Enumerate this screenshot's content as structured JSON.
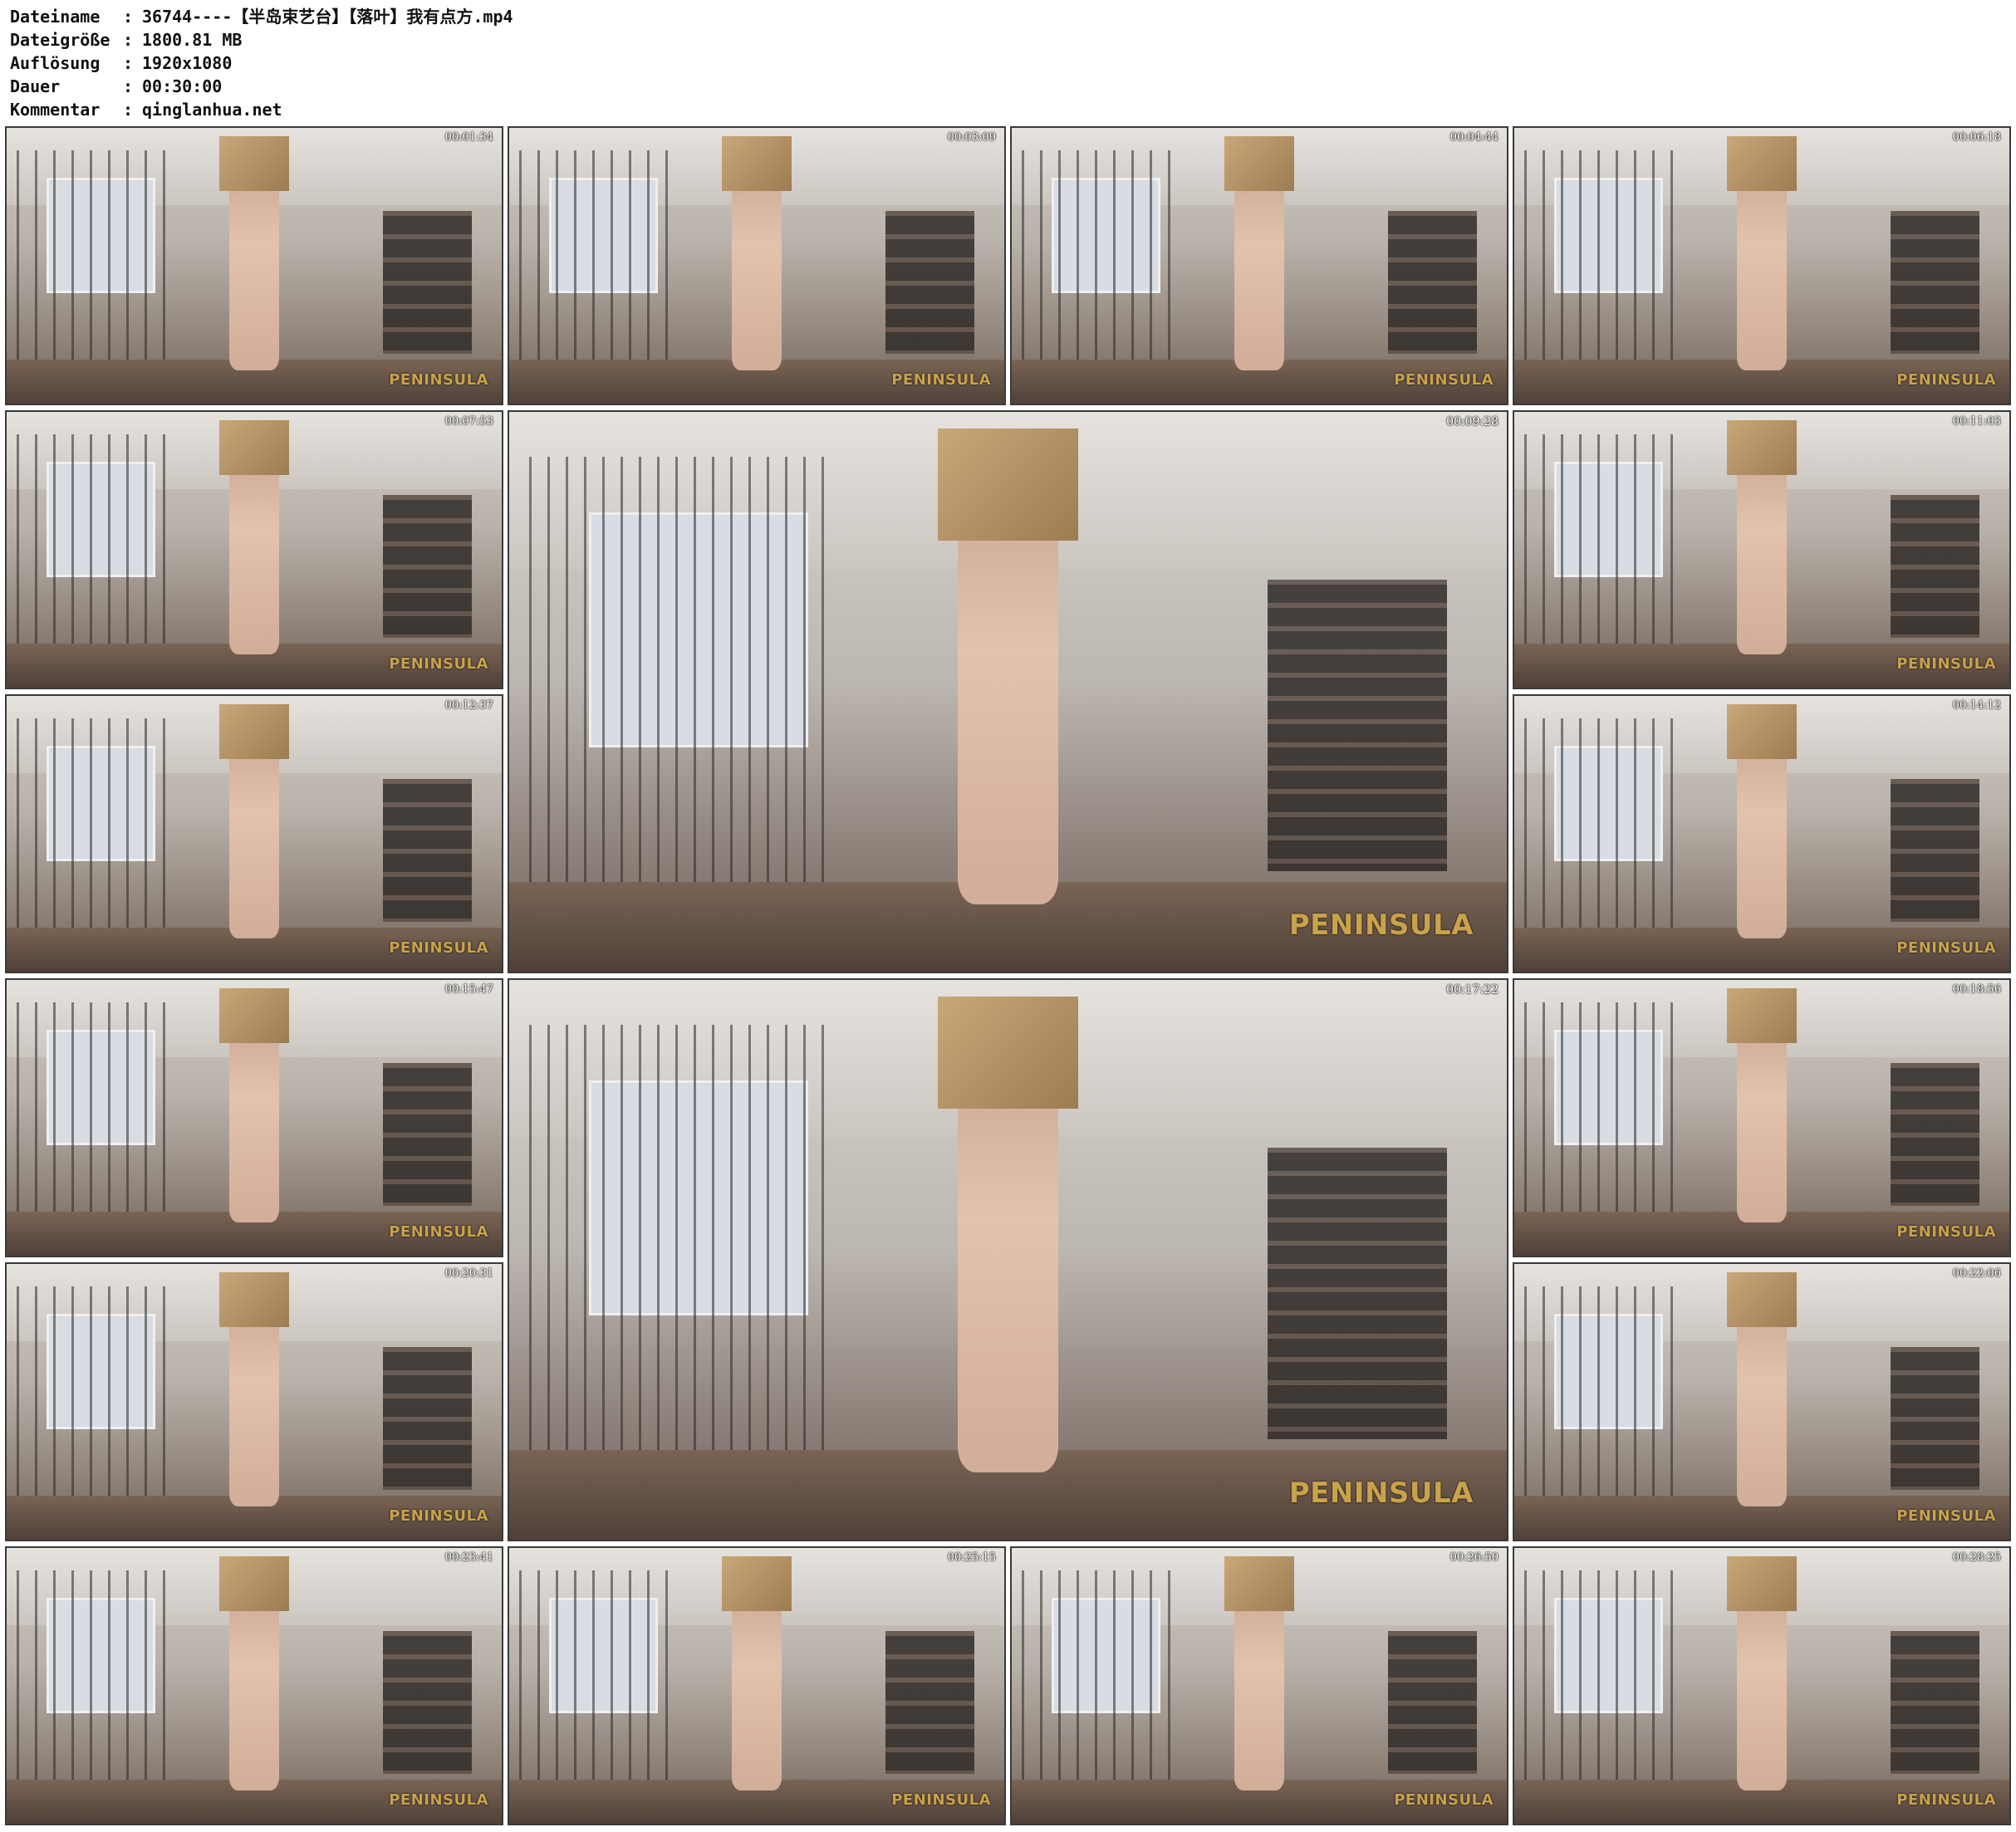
{
  "header": {
    "rows": [
      {
        "label": "Dateiname",
        "sep": ":",
        "value": "36744----【半岛束艺台】【落叶】我有点方.mp4"
      },
      {
        "label": "Dateigröße",
        "sep": ":",
        "value": "1800.81 MB"
      },
      {
        "label": "Auflösung",
        "sep": ":",
        "value": "1920x1080"
      },
      {
        "label": "Dauer",
        "sep": ":",
        "value": "00:30:00"
      },
      {
        "label": "Kommentar",
        "sep": ":",
        "value": "qinglanhua.net"
      }
    ]
  },
  "logo_text": "PENINSULA",
  "thumbnails": [
    {
      "timestamp": "00:01:34",
      "large": false
    },
    {
      "timestamp": "00:03:09",
      "large": false
    },
    {
      "timestamp": "00:04:44",
      "large": false
    },
    {
      "timestamp": "00:06:18",
      "large": false
    },
    {
      "timestamp": "00:07:53",
      "large": false
    },
    {
      "timestamp": "00:09:28",
      "large": true
    },
    {
      "timestamp": "00:11:03",
      "large": false
    },
    {
      "timestamp": "00:12:37",
      "large": false
    },
    {
      "timestamp": "00:14:12",
      "large": false
    },
    {
      "timestamp": "00:15:47",
      "large": false
    },
    {
      "timestamp": "00:17:22",
      "large": true
    },
    {
      "timestamp": "00:18:56",
      "large": false
    },
    {
      "timestamp": "00:20:31",
      "large": false
    },
    {
      "timestamp": "00:22:06",
      "large": false
    },
    {
      "timestamp": "00:23:41",
      "large": false
    },
    {
      "timestamp": "00:25:15",
      "large": false
    },
    {
      "timestamp": "00:26:50",
      "large": false
    },
    {
      "timestamp": "00:28:25",
      "large": false
    }
  ]
}
